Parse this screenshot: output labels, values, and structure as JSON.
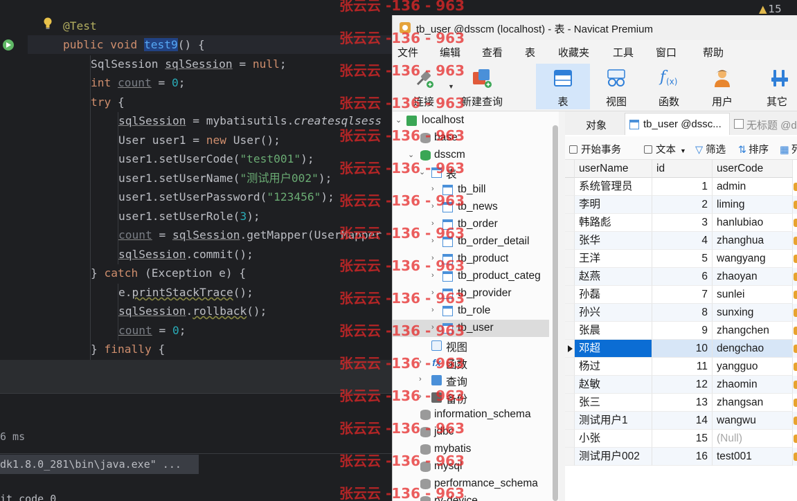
{
  "ide": {
    "warning_count": "15",
    "code": {
      "l1": "@Test",
      "l2_kw1": "public",
      "l2_kw2": "void",
      "l2_fn": "test9",
      "l2_rest": "() {",
      "l3_type": "SqlSession ",
      "l3_var": "sqlSession",
      "l3_eq": " = ",
      "l3_null": "null",
      "l3_end": ";",
      "l4_kw": "int",
      "l4_sp": " ",
      "l4_var": "count",
      "l4_eq": " = ",
      "l4_num": "0",
      "l4_end": ";",
      "l5_kw": "try",
      "l5_rest": " {",
      "l6_var": "sqlSession",
      "l6_mid": " = mybatisutils.",
      "l6_method": "createsqlsess",
      "l7_a": "User user1 = ",
      "l7_kw": "new",
      "l7_b": " User();",
      "l8_a": "user1.setUserCode(",
      "l8_str": "\"test001\"",
      "l8_b": ");",
      "l9_a": "user1.setUserName(",
      "l9_str": "\"测试用户002\"",
      "l9_b": ");",
      "l10_a": "user1.setUserPassword(",
      "l10_str": "\"123456\"",
      "l10_b": ");",
      "l11_a": "user1.setUserRole(",
      "l11_num": "3",
      "l11_b": ");",
      "l12_var1": "count",
      "l12_eq": " = ",
      "l12_var2": "sqlSession",
      "l12_rest": ".getMapper(UserMapper",
      "l13_var": "sqlSession",
      "l13_rest": ".commit();",
      "l14_a": "} ",
      "l14_kw": "catch",
      "l14_b": " (Exception e) {",
      "l15_a": "e.",
      "l15_m": "printStackTrace",
      "l15_b": "();",
      "l16_var": "sqlSession",
      "l16_dot": ".",
      "l16_m": "rollback",
      "l16_b": "();",
      "l17_var": "count",
      "l17_eq": " = ",
      "l17_num": "0",
      "l17_end": ";",
      "l18_a": "} ",
      "l18_kw": "finally",
      "l18_b": " {"
    },
    "run": {
      "time": "6 ms",
      "command": "dk1.8.0_281\\bin\\java.exe\" ...",
      "exit": "it code 0"
    }
  },
  "navicat": {
    "title": "tb_user @dsscm (localhost) - 表 - Navicat Premium",
    "menu": [
      "文件",
      "编辑",
      "查看",
      "表",
      "收藏夹",
      "工具",
      "窗口",
      "帮助"
    ],
    "toolbar": {
      "connect": "连接",
      "new_query": "新建查询",
      "table": "表",
      "view": "视图",
      "function": "函数",
      "user": "用户",
      "other": "其它"
    },
    "tree": {
      "localhost": "localhost",
      "base": "base",
      "dsscm": "dsscm",
      "tables": "表",
      "tables_list": [
        "tb_bill",
        "tb_news",
        "tb_order",
        "tb_order_detail",
        "tb_product",
        "tb_product_categ",
        "tb_provider",
        "tb_role",
        "tb_user"
      ],
      "views": "视图",
      "functions": "函数",
      "queries": "查询",
      "backups": "备份",
      "other_dbs": [
        "information_schema",
        "jdbc",
        "mybatis",
        "mysql",
        "performance_schema",
        "ry-device"
      ]
    },
    "tabs": {
      "objects": "对象",
      "tb_user": "tb_user @dssc...",
      "untitled": "无标题 @d"
    },
    "actions": {
      "begin_tx": "开始事务",
      "text": "文本",
      "filter": "筛选",
      "sort": "排序",
      "col": "列"
    },
    "grid": {
      "headers": [
        "userName",
        "id",
        "userCode"
      ],
      "rows": [
        [
          "系统管理员",
          "1",
          "admin"
        ],
        [
          "李明",
          "2",
          "liming"
        ],
        [
          "韩路彪",
          "3",
          "hanlubiao"
        ],
        [
          "张华",
          "4",
          "zhanghua"
        ],
        [
          "王洋",
          "5",
          "wangyang"
        ],
        [
          "赵燕",
          "6",
          "zhaoyan"
        ],
        [
          "孙磊",
          "7",
          "sunlei"
        ],
        [
          "孙兴",
          "8",
          "sunxing"
        ],
        [
          "张晨",
          "9",
          "zhangchen"
        ],
        [
          "邓超",
          "10",
          "dengchao"
        ],
        [
          "杨过",
          "11",
          "yangguo"
        ],
        [
          "赵敏",
          "12",
          "zhaomin"
        ],
        [
          "张三",
          "13",
          "zhangsan"
        ],
        [
          "测试用户1",
          "14",
          "wangwu"
        ],
        [
          "小张",
          "15",
          "(Null)"
        ],
        [
          "测试用户002",
          "16",
          "test001"
        ]
      ]
    }
  },
  "watermark": "张云云 -136 - 963"
}
